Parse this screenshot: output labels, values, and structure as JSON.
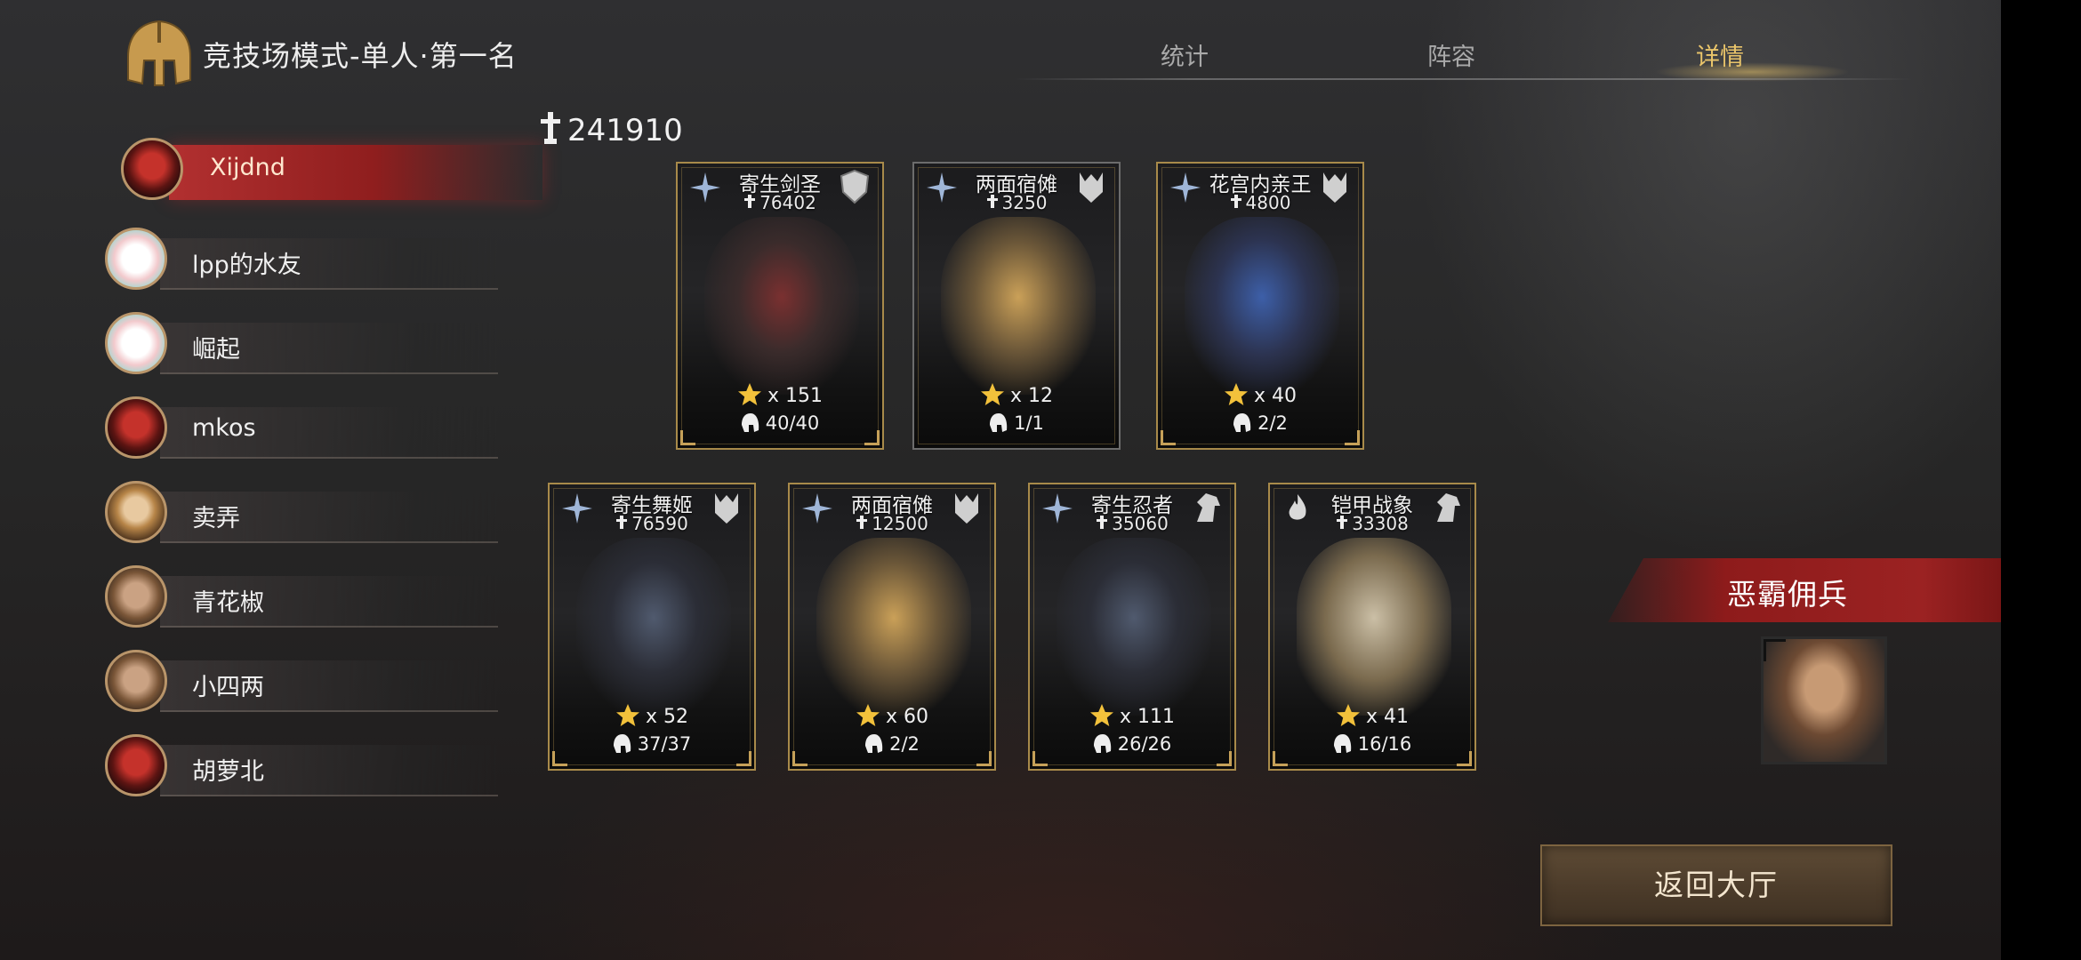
{
  "header": {
    "title": "竞技场模式-单人·第一名",
    "tabs": [
      {
        "label": "统计",
        "active": false
      },
      {
        "label": "阵容",
        "active": false
      },
      {
        "label": "详情",
        "active": true
      }
    ]
  },
  "players": [
    {
      "name": "Xijdnd",
      "avatar": "demon-mask-avatar",
      "selected": true
    },
    {
      "name": "lpp的水友",
      "avatar": "pink-bubble-avatar",
      "selected": false
    },
    {
      "name": "崛起",
      "avatar": "pink-bubble-avatar",
      "selected": false
    },
    {
      "name": "mkos",
      "avatar": "demon-mask-avatar",
      "selected": false
    },
    {
      "name": "卖弄",
      "avatar": "woman-portrait-avatar",
      "selected": false
    },
    {
      "name": "青花椒",
      "avatar": "bearded-man-avatar",
      "selected": false
    },
    {
      "name": "小四两",
      "avatar": "bearded-man-avatar",
      "selected": false
    },
    {
      "name": "胡萝北",
      "avatar": "demon-mask-avatar",
      "selected": false
    }
  ],
  "total_power": "241910",
  "units": [
    {
      "name": "寄生剑圣",
      "power": "76402",
      "stars": "x 151",
      "count": "40/40",
      "element_icon": "ice-star-icon",
      "class_icon": "shield-icon",
      "frame": "gold"
    },
    {
      "name": "两面宿傩",
      "power": "3250",
      "stars": "x 12",
      "count": "1/1",
      "element_icon": "ice-star-icon",
      "class_icon": "demon-helm-icon",
      "frame": "plain"
    },
    {
      "name": "花宫内亲王",
      "power": "4800",
      "stars": "x 40",
      "count": "2/2",
      "element_icon": "ice-star-icon",
      "class_icon": "demon-helm-icon",
      "frame": "gold"
    },
    {
      "name": "寄生舞姬",
      "power": "76590",
      "stars": "x 52",
      "count": "37/37",
      "element_icon": "ice-star-icon",
      "class_icon": "demon-helm-icon",
      "frame": "gold"
    },
    {
      "name": "两面宿傩",
      "power": "12500",
      "stars": "x 60",
      "count": "2/2",
      "element_icon": "ice-star-icon",
      "class_icon": "demon-helm-icon",
      "frame": "gold"
    },
    {
      "name": "寄生忍者",
      "power": "35060",
      "stars": "x 111",
      "count": "26/26",
      "element_icon": "ice-star-icon",
      "class_icon": "horse-head-icon",
      "frame": "gold"
    },
    {
      "name": "铠甲战象",
      "power": "33308",
      "stars": "x 41",
      "count": "16/16",
      "element_icon": "flame-icon",
      "class_icon": "horse-head-icon",
      "frame": "gold"
    }
  ],
  "mercenary": {
    "label": "恶霸佣兵",
    "portrait": "barbarian-portrait"
  },
  "back_button": "返回大厅",
  "colors": {
    "accent_gold": "#e9c46a",
    "selected_red": "#b23030",
    "banner_red": "#9b2222"
  }
}
